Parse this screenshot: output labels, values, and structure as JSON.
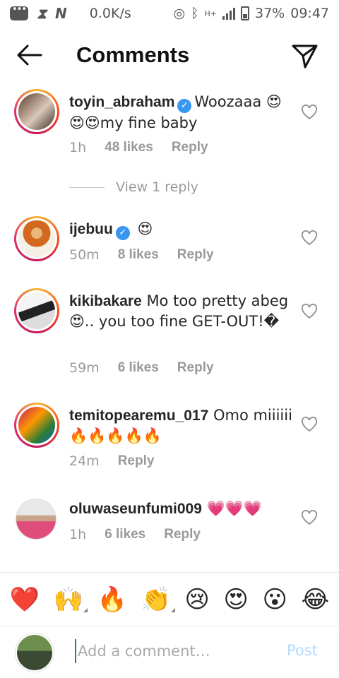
{
  "status_bar": {
    "network_speed": "0.0K/s",
    "network_type": "H+",
    "battery": "37%",
    "time": "09:47",
    "icons": [
      "notification-icon",
      "hourglass-icon",
      "n-icon",
      "hotspot-icon",
      "bluetooth-icon",
      "signal-icon",
      "battery-icon"
    ]
  },
  "header": {
    "title": "Comments",
    "back_icon": "arrow-left-icon",
    "send_icon": "paper-plane-icon"
  },
  "comments": [
    {
      "user": "toyin_abraham",
      "verified": true,
      "text": "Woozaaa 😍😍😍my fine baby",
      "time": "1h",
      "likes": "48 likes",
      "reply": "Reply"
    },
    {
      "user": "ijebuu",
      "verified": true,
      "text": "😍",
      "time": "50m",
      "likes": "8 likes",
      "reply": "Reply"
    },
    {
      "user": "kikibakare",
      "verified": false,
      "text": "Mo too pretty abeg😍.. you too fine GET-OUT!�",
      "time": "59m",
      "likes": "6 likes",
      "reply": "Reply"
    },
    {
      "user": "temitopearemu_017",
      "verified": false,
      "text": "Omo miiiiii🔥🔥🔥🔥🔥",
      "time": "24m",
      "likes": "",
      "reply": "Reply"
    },
    {
      "user": "oluwaseunfumi009",
      "verified": false,
      "text": "💗💗💗",
      "time": "1h",
      "likes": "6 likes",
      "reply": "Reply"
    }
  ],
  "view_replies": "View 1 reply",
  "emoji_bar": [
    "❤️",
    "🙌",
    "🔥",
    "👏",
    "😢",
    "😍",
    "😮",
    "😂"
  ],
  "composer": {
    "placeholder": "Add a comment…",
    "post_label": "Post"
  },
  "colors": {
    "accent_blue": "#3897f0",
    "post_disabled": "#b3dbff",
    "meta_gray": "#999999"
  }
}
